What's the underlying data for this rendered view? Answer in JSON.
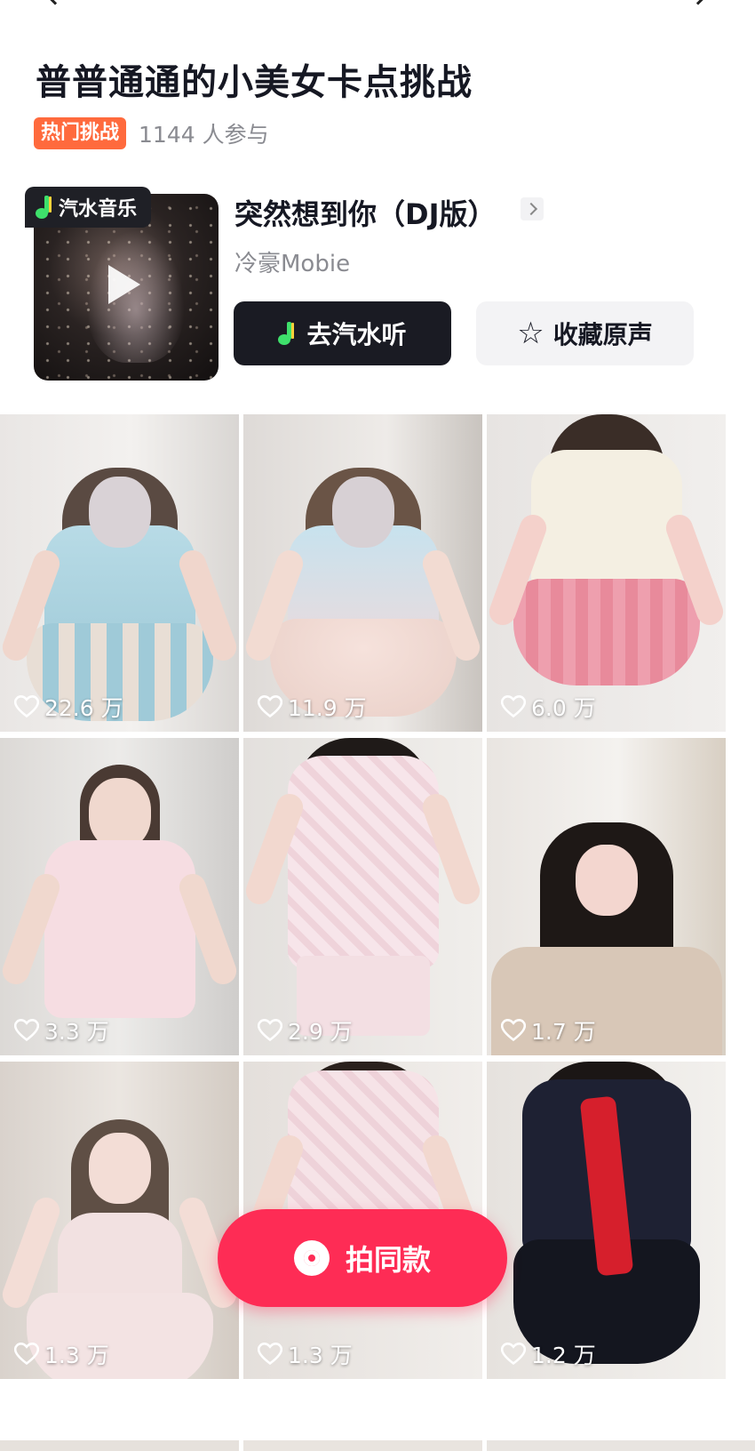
{
  "challenge": {
    "title": "普普通通的小美女卡点挑战",
    "badge": "热门挑战",
    "participants": "1144 人参与"
  },
  "music": {
    "badge_label": "汽水音乐",
    "song_title": "突然想到你（DJ版）",
    "artist": "冷豪Mobie",
    "listen_button": "去汽水听",
    "favorite_button": "收藏原声",
    "icons": [
      "music-note-icon",
      "play-icon",
      "chevron-right-icon",
      "star-icon"
    ]
  },
  "videos": [
    {
      "likes": "22.6 万",
      "palette": "lolita-blue"
    },
    {
      "likes": "11.9 万",
      "palette": "lolita-pink-blue"
    },
    {
      "likes": "6.0 万",
      "palette": "pink-skirt"
    },
    {
      "likes": "3.3 万",
      "palette": "pink-pajamas"
    },
    {
      "likes": "2.9 万",
      "palette": "print-pajamas"
    },
    {
      "likes": "1.7 万",
      "palette": "beige-shirt"
    },
    {
      "likes": "1.3 万",
      "palette": "pink-dress"
    },
    {
      "likes": "1.3 万",
      "palette": "pink-pajamas-2"
    },
    {
      "likes": "1.2 万",
      "palette": "sailor-uniform"
    }
  ],
  "shoot_button": "拍同款",
  "colors": {
    "accent": "#fe2c55",
    "hot_badge": "#ff6a3d",
    "dark_button": "#1a1b23",
    "secondary_text": "#8a8b91"
  }
}
